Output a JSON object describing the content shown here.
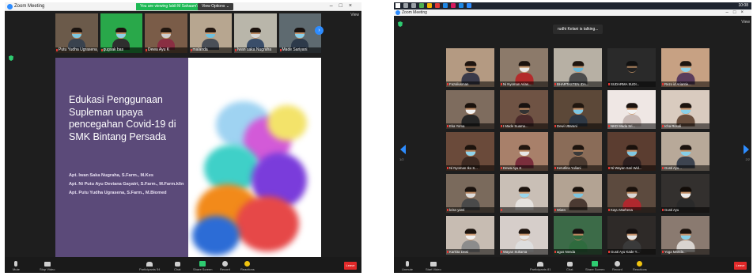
{
  "left": {
    "window_title": "Zoom Meeting",
    "share_notice": "You are viewing Ialdi M Sahaam's screen",
    "view_options": "View Options ⌄",
    "view_label": "View",
    "window_controls": [
      "–",
      "□",
      "×"
    ],
    "thumbnails": [
      {
        "name": "Putu Yudha Ugrasena_ap",
        "bg": "#6b5a4a",
        "skin": "#b8845c",
        "hair": "#1b1410",
        "mask": "#7ec7e0",
        "shirt": "#39424e"
      },
      {
        "name": "gugsak bas",
        "bg": "#29a84a",
        "skin": "#c28f66",
        "hair": "#1c1410",
        "mask": "#8cd2e6",
        "shirt": "#2e2e2e"
      },
      {
        "name": "Dewa Ayu K",
        "bg": "#7a5c48",
        "skin": "#c9956b",
        "hair": "#221710",
        "mask": "#cfcfcf",
        "shirt": "#8a2e42"
      },
      {
        "name": "malanda",
        "bg": "#b7a690",
        "skin": "#c79a70",
        "hair": "#231812",
        "mask": "#6fc0de",
        "shirt": "#4a4f57"
      },
      {
        "name": "Iwan saka Nugraha",
        "bg": "#b9b6aa",
        "skin": "#b7855f",
        "hair": "#1b130e",
        "mask": "#d8d8d8",
        "shirt": "#3a4e6a"
      },
      {
        "name": "Made Sariyani",
        "bg": "#5e6a70",
        "skin": "#c4926a",
        "hair": "#181210",
        "mask": "#8ad0ea",
        "shirt": "#2d3a4a"
      }
    ],
    "slide": {
      "title": "Edukasi Penggunaan Supleman upaya pencegahan Covid-19 di SMK Bintang Persada",
      "presenters": [
        "Apt. Iwan Saka Nugraha, S.Farm., M.Kes",
        "Apt. Ni Putu Ayu Deviana Gayatri, S.Farm., M.Farm.klin",
        "Apt. Putu Yudha Ugrasena, S.Farm., M.Biomed"
      ]
    },
    "toolbar": {
      "mute": "Mute",
      "stop_video": "Stop Video",
      "participants": "Participants",
      "participants_count": "54",
      "chat": "Chat",
      "share_screen": "Share Screen",
      "record": "Record",
      "reactions": "Reactions",
      "leave": "Leave"
    }
  },
  "right": {
    "window_title": "Zoom Meeting",
    "talking_notice": "rudhi Kelani is talking...",
    "view_label": "View",
    "clock": "10:08",
    "window_controls": [
      "–",
      "□",
      "×"
    ],
    "page_left": "1/2",
    "page_right": "2/2",
    "tiles": [
      {
        "name": "Fazaliusman",
        "bg": "#b49a82",
        "skin": "#c4926a",
        "hair": "#1f1510",
        "mask": "#2e2e2e",
        "shirt": "#3a3a4a"
      },
      {
        "name": "Ni Nyoman Arias...",
        "bg": "#8c7a6a",
        "skin": "#c99a70",
        "hair": "#1a120e",
        "mask": "#e8e8e8",
        "shirt": "#b32b2b"
      },
      {
        "name": "BHARTASTEN IDA...",
        "bg": "#b7b0a4",
        "skin": "#c79469",
        "hair": "#1e150f",
        "mask": "#6ab8d8",
        "shirt": "#4c4c4c"
      },
      {
        "name": "SUDARMA SUDI...",
        "bg": "#2a2a2a",
        "skin": "#a8805c",
        "hair": "#111",
        "mask": "#222",
        "shirt": "#2a2a2a"
      },
      {
        "name": "Rezo id Ariantie...",
        "bg": "#c7a183",
        "skin": "#cc9a6f",
        "hair": "#1d1510",
        "mask": "#90d3ea",
        "shirt": "#5a3c5c"
      },
      {
        "name": "Eka Yoma",
        "bg": "#7e6c5e",
        "skin": "#b88660",
        "hair": "#1a120d",
        "mask": "#f0f0f0",
        "shirt": "#262626"
      },
      {
        "name": "I Made Suama...",
        "bg": "#6f5344",
        "skin": "#b9855f",
        "hair": "#181210",
        "mask": "#333",
        "shirt": "#4b2a2a"
      },
      {
        "name": "Dewi Uttarani",
        "bg": "#5c4838",
        "skin": "#c3906a",
        "hair": "#20160f",
        "mask": "#7cc6e2",
        "shirt": "#2e3844"
      },
      {
        "name": "NKD Mada Sri...",
        "bg": "#efe7e4",
        "skin": "#d0a07a",
        "hair": "#1a120e",
        "mask": "#f2f2f2",
        "shirt": "#c7b8b4"
      },
      {
        "name": "Icha Rosali",
        "bg": "#d9cbbf",
        "skin": "#cc9a73",
        "hair": "#1b130e",
        "mask": "#8ad1ea",
        "shirt": "#6a4f3e"
      },
      {
        "name": "Ni Nyoman Iko S...",
        "bg": "#6a4a3a",
        "skin": "#b58159",
        "hair": "#1c130d",
        "mask": "#90d4ec",
        "shirt": "#3d2a22"
      },
      {
        "name": "Dewa Ayu K",
        "bg": "#a8806a",
        "skin": "#c18d66",
        "hair": "#221710",
        "mask": "#e6e6e6",
        "shirt": "#7a2e3c"
      },
      {
        "name": "Ketutlina Yuliani",
        "bg": "#8a6c58",
        "skin": "#bf8c64",
        "hair": "#1d140e",
        "mask": "#3a3a3a",
        "shirt": "#4a3a30"
      },
      {
        "name": "Ni Wayan Sari Wid...",
        "bg": "#5b3d30",
        "skin": "#c4916a",
        "hair": "#1a110c",
        "mask": "#7fc8e4",
        "shirt": "#2e2020"
      },
      {
        "name": "Gusti Ayu...",
        "bg": "#b8a999",
        "skin": "#c8986e",
        "hair": "#1c140f",
        "mask": "#86cfe8",
        "shirt": "#3d4450"
      },
      {
        "name": "krisn yanti",
        "bg": "#7a6a5c",
        "skin": "#b98760",
        "hair": "#1b130e",
        "mask": "#dcdcdc",
        "shirt": "#4a4a4a"
      },
      {
        "name": "",
        "bg": "#c9bfb6",
        "skin": "#cf9e76",
        "hair": "#1d140f",
        "mask": "#9ad6ec",
        "shirt": "#e5e2df"
      },
      {
        "name": "Wiatn",
        "bg": "#b3a393",
        "skin": "#c29068",
        "hair": "#1a120d",
        "mask": "#7bc4e0",
        "shirt": "#4b3a32"
      },
      {
        "name": "Kayu Marhena",
        "bg": "#5c4a3e",
        "skin": "#bb885f",
        "hair": "#1a110c",
        "mask": "#d8d8d8",
        "shirt": "#b0282e"
      },
      {
        "name": "Gusti Ayu",
        "bg": "#33302e",
        "skin": "#c08c64",
        "hair": "#120c08",
        "mask": "#ececec",
        "shirt": "#2a2a2a"
      },
      {
        "name": "Karkita Dewi",
        "bg": "#c7bcb2",
        "skin": "#cd9c74",
        "hair": "#1c130e",
        "mask": "#f0f0f0",
        "shirt": "#8c8c8c"
      },
      {
        "name": "Wayan Sukarsa",
        "bg": "#d6ceca",
        "skin": "#c8986f",
        "hair": "#1e150f",
        "mask": "#e8e8e8",
        "shirt": "#dedede"
      },
      {
        "name": "agus Nenda",
        "bg": "#3c6b48",
        "skin": "#b9865e",
        "hair": "#181110",
        "mask": "#2f6b3e",
        "shirt": "#2f6b3e"
      },
      {
        "name": "Gusti Ayu Kade Y...",
        "bg": "#2e2a28",
        "skin": "#c4926b",
        "hair": "#141010",
        "mask": "#e4e4e4",
        "shirt": "#3a3a3a"
      },
      {
        "name": "Yoga Manda...",
        "bg": "#8a7a70",
        "skin": "#c6956d",
        "hair": "#1c130e",
        "mask": "#86cfe8",
        "shirt": "#d9d4d0"
      }
    ],
    "toolbar": {
      "unmute": "Unmute",
      "start_video": "Start Video",
      "participants": "Participants",
      "participants_count": "81",
      "chat": "Chat",
      "share_screen": "Share Screen",
      "record": "Record",
      "reactions": "Reactions",
      "leave": "Leave"
    }
  }
}
